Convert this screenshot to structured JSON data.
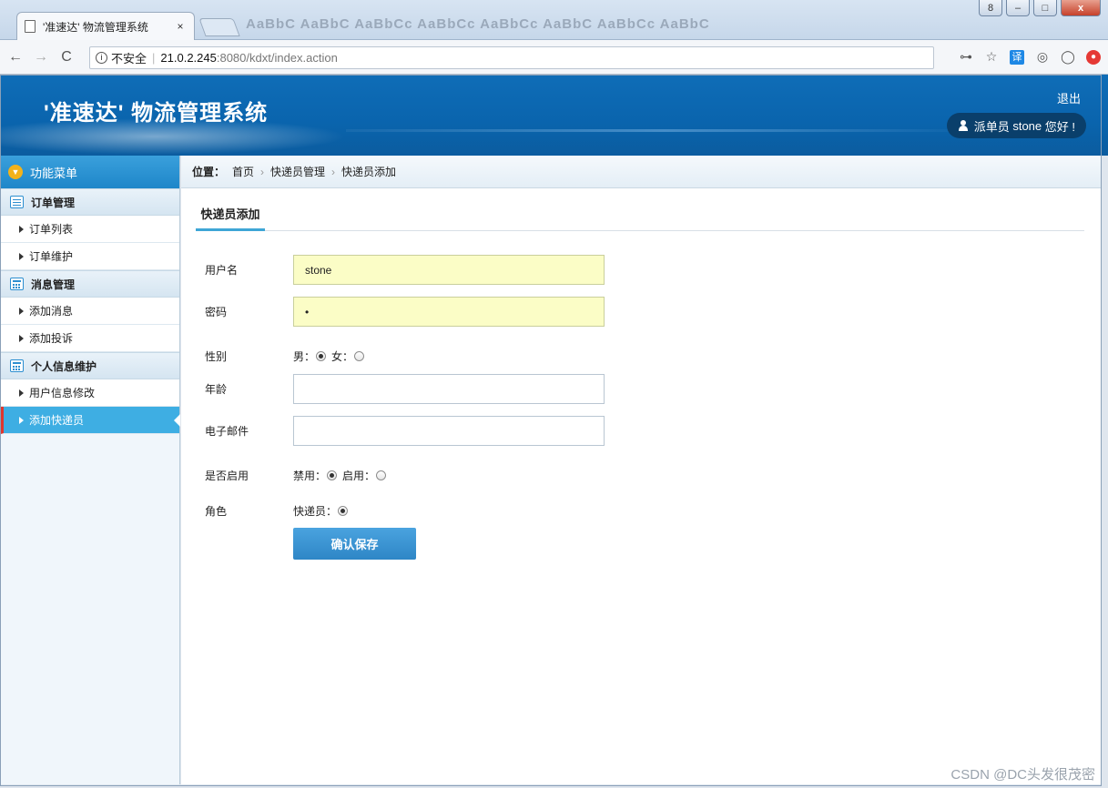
{
  "browser": {
    "tab_title": "'准速达' 物流管理系统",
    "tab_close": "×",
    "styles_strip": "AaBbC AaBbC AaBbCc AaBbCc AaBbCc AaBbC AaBbCc AaBbC",
    "url_security": "不安全",
    "url_host": "21.0.2.245",
    "url_rest": ":8080/kdxt/index.action",
    "nav_back": "←",
    "nav_forward": "→",
    "nav_reload": "C",
    "win_min": "–",
    "win_max": "□",
    "win_close": "x",
    "win_user": "8",
    "ext_key": "⊶",
    "ext_star": "☆",
    "ext_translate": "译",
    "ext_circle1": "◎",
    "ext_circle2": "◯",
    "ext_red": "●"
  },
  "header": {
    "title": "'准速达' 物流管理系统",
    "logout": "退出",
    "role": "派单员",
    "username": "stone",
    "greeting": "您好 !"
  },
  "sidebar": {
    "menu_title": "功能菜单",
    "groups": [
      {
        "label": "订单管理",
        "items": [
          "订单列表",
          "订单维护"
        ]
      },
      {
        "label": "消息管理",
        "items": [
          "添加消息",
          "添加投诉"
        ]
      },
      {
        "label": "个人信息维护",
        "items": [
          "用户信息修改",
          "添加快递员"
        ]
      }
    ],
    "active_item": "添加快递员"
  },
  "breadcrumb": {
    "label": "位置：",
    "items": [
      "首页",
      "快递员管理",
      "快递员添加"
    ],
    "separator": "›"
  },
  "tab": {
    "label": "快递员添加"
  },
  "form": {
    "username_label": "用户名",
    "username_value": "stone",
    "password_label": "密码",
    "password_value": "•",
    "gender_label": "性别",
    "gender_male": "男：",
    "gender_female": "女：",
    "gender_selected": "男",
    "age_label": "年龄",
    "age_value": "",
    "email_label": "电子邮件",
    "email_value": "",
    "enabled_label": "是否启用",
    "enabled_disabled": "禁用：",
    "enabled_enabled": "启用：",
    "enabled_selected": "禁用",
    "role_label": "角色",
    "role_courier": "快递员：",
    "save_label": "确认保存"
  },
  "watermark": "CSDN @DC头发很茂密",
  "colors": {
    "header_blue": "#0f6db7",
    "menu_blue": "#1e86c9",
    "active_item": "#3eaee3",
    "active_marker": "#e0362e",
    "button_blue": "#2e86c6",
    "input_fill": "#fbfdc6"
  }
}
